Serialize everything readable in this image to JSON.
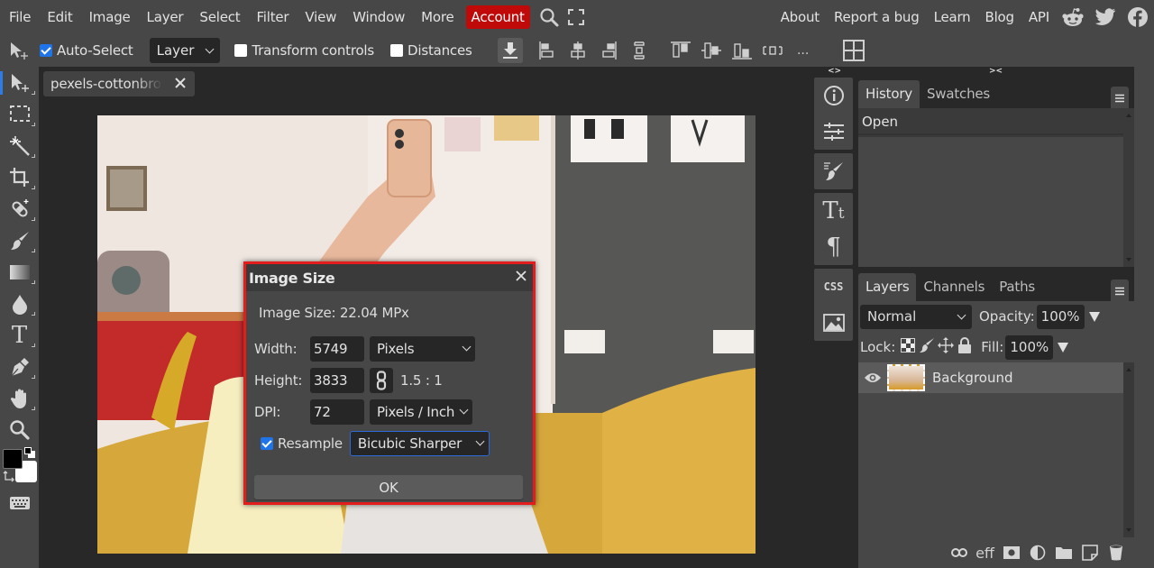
{
  "menubar": {
    "items": [
      "File",
      "Edit",
      "Image",
      "Layer",
      "Select",
      "Filter",
      "View",
      "Window",
      "More"
    ],
    "account": "Account",
    "account_color": "#c00a0a",
    "right_links": [
      "About",
      "Report a bug",
      "Learn",
      "Blog",
      "API"
    ],
    "icons": [
      "search-icon",
      "fullscreen-icon",
      "reddit-icon",
      "twitter-icon",
      "facebook-icon"
    ]
  },
  "options": {
    "auto_select_label": "Auto-Select",
    "auto_select_checked": true,
    "layer_select": "Layer",
    "transform_controls_label": "Transform controls",
    "transform_controls_checked": false,
    "distances_label": "Distances",
    "distances_checked": false,
    "more_label": "..."
  },
  "document": {
    "tab_name": "pexels-cottonbro-"
  },
  "dock": {
    "collapse_left": "<>",
    "collapse_right": "><"
  },
  "history_panel": {
    "tabs": [
      "History",
      "Swatches"
    ],
    "active_tab": "History",
    "items": [
      "Open"
    ]
  },
  "layers_panel": {
    "tabs": [
      "Layers",
      "Channels",
      "Paths"
    ],
    "active_tab": "Layers",
    "blend_mode": "Normal",
    "opacity_label": "Opacity:",
    "opacity": "100%",
    "lock_label": "Lock:",
    "fill_label": "Fill:",
    "fill": "100%",
    "layers": [
      {
        "name": "Background",
        "visible": true
      }
    ],
    "footer_effects_label": "eff"
  },
  "css_label": "CSS",
  "dialog": {
    "title": "Image Size",
    "info": "Image Size: 22.04 MPx",
    "width_label": "Width:",
    "width_value": "5749",
    "width_unit": "Pixels",
    "height_label": "Height:",
    "height_value": "3833",
    "ratio": "1.5 : 1",
    "dpi_label": "DPI:",
    "dpi_value": "72",
    "dpi_unit": "Pixels / Inch",
    "resample_label": "Resample",
    "resample_checked": true,
    "resample_method": "Bicubic Sharper",
    "ok_label": "OK",
    "highlight_color": "#e21d1d"
  }
}
